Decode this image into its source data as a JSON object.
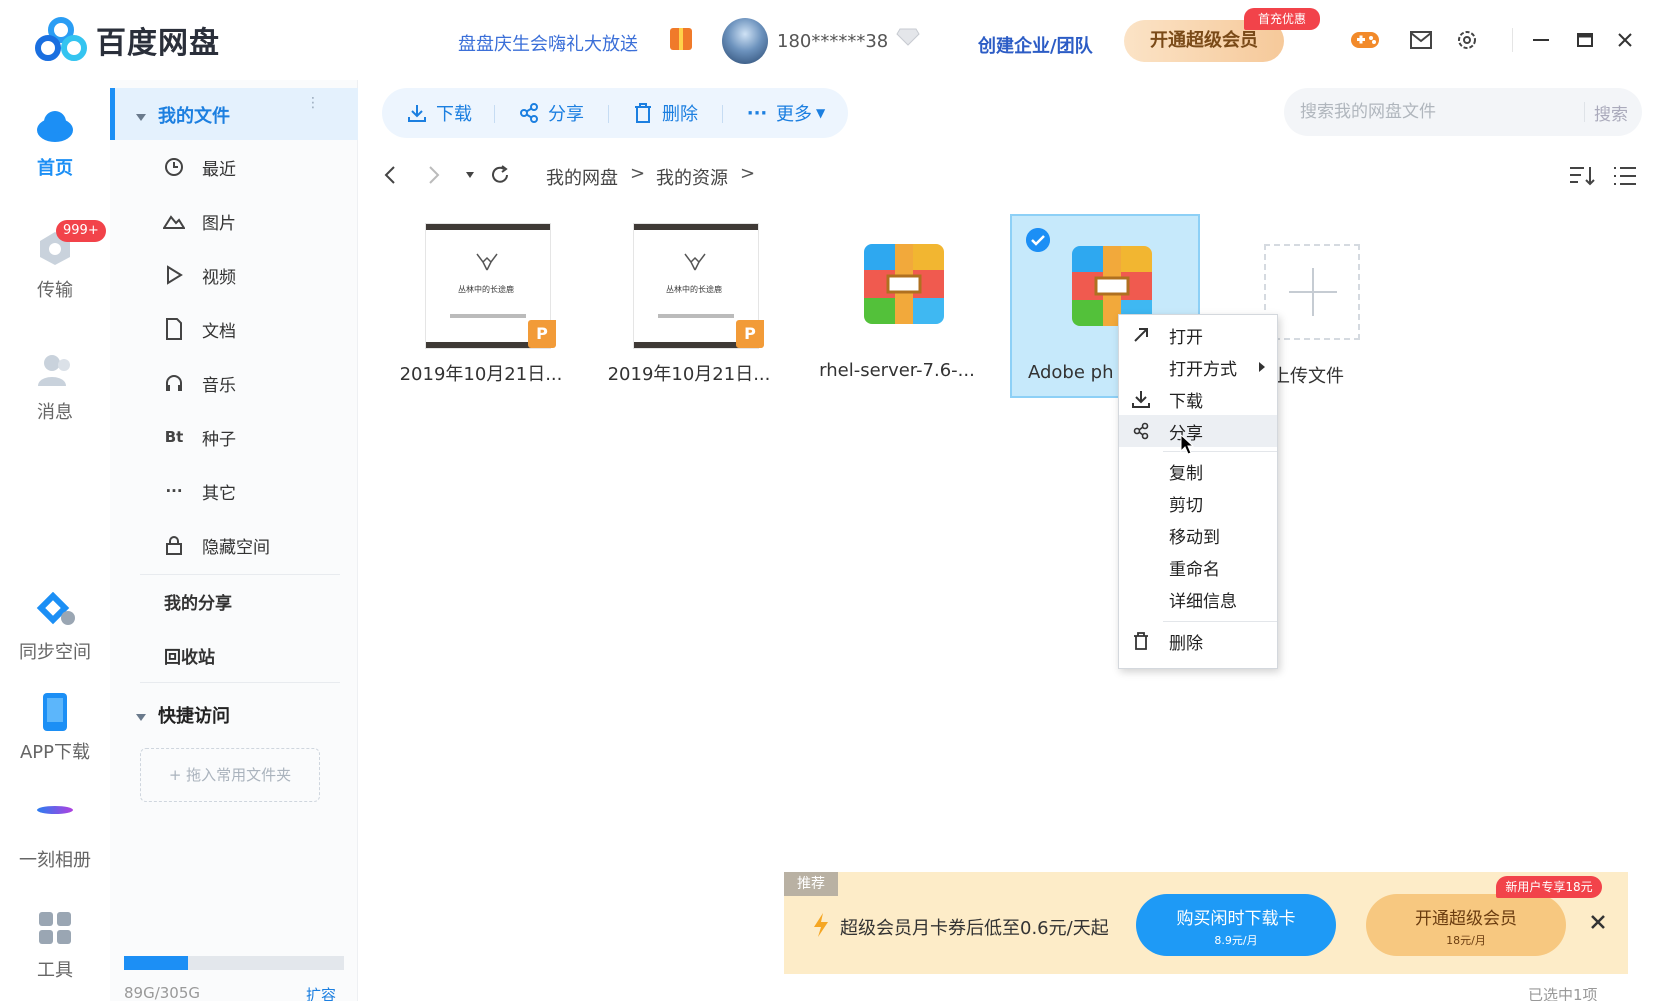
{
  "app": {
    "title": "百度网盘",
    "promo": "盘盘庆生会嗨礼大放送",
    "username": "180******38",
    "create_team": "创建企业/团队",
    "vip_button": "开通超级会员",
    "vip_badge": "首充优惠"
  },
  "rail": {
    "home": "首页",
    "transfer": "传输",
    "transfer_badge": "999+",
    "messages": "消息",
    "sync": "同步空间",
    "app_download": "APP下载",
    "album": "一刻相册",
    "tools": "工具"
  },
  "nav": {
    "my_files": "我的文件",
    "items": [
      "最近",
      "图片",
      "视频",
      "文档",
      "音乐",
      "种子",
      "其它",
      "隐藏空间"
    ],
    "my_share": "我的分享",
    "recycle": "回收站",
    "quick_access": "快捷访问",
    "drop_folder": "+ 拖入常用文件夹",
    "storage": "89G/305G",
    "storage_used_fraction": 0.29,
    "expand": "扩容"
  },
  "toolbar": {
    "download": "下载",
    "share": "分享",
    "delete": "删除",
    "more": "更多"
  },
  "search": {
    "placeholder": "搜索我的网盘文件",
    "button": "搜索"
  },
  "breadcrumb": [
    "我的网盘",
    "我的资源"
  ],
  "files": [
    {
      "name": "2019年10月21日...",
      "type": "ppt",
      "doc_title": "丛林中的长途鹿",
      "badge": "P"
    },
    {
      "name": "2019年10月21日...",
      "type": "ppt",
      "doc_title": "丛林中的长途鹿",
      "badge": "P"
    },
    {
      "name": "rhel-server-7.6-...",
      "type": "zip"
    },
    {
      "name": "Adobe ph",
      "type": "zip",
      "selected": true
    }
  ],
  "upload": "上传文件",
  "context_menu": {
    "open": "打开",
    "open_with": "打开方式",
    "download": "下载",
    "share": "分享",
    "copy": "复制",
    "cut": "剪切",
    "move_to": "移动到",
    "rename": "重命名",
    "details": "详细信息",
    "delete": "删除"
  },
  "ad": {
    "tag": "推荐",
    "text": "超级会员月卡券后低至0.6元/天起",
    "btn1_main": "购买闲时下载卡",
    "btn1_sub": "8.9元/月",
    "btn2_main": "开通超级会员",
    "btn2_sub": "18元/月",
    "new_badge": "新用户专享18元"
  },
  "status": "已选中1项",
  "colors": {
    "accent": "#1c8ff5",
    "selected_bg": "#c6e9fb",
    "ad_bg": "#fdecc8",
    "badge_red": "#f2434a"
  }
}
